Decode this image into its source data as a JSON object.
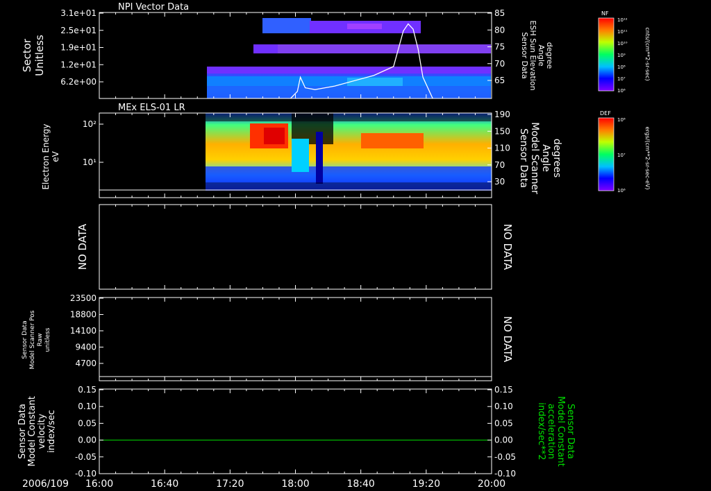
{
  "chart_data": [
    {
      "type": "heatmap",
      "title": "NPI Vector Data",
      "ylabel": [
        "Sector",
        "Unitless"
      ],
      "yticks": [
        "3.1e+01",
        "2.5e+01",
        "1.9e+01",
        "1.2e+01",
        "6.2e+00"
      ],
      "right_ylabel": [
        "Sensor Data",
        "ESH Sun Elevation",
        "Angle",
        "degree"
      ],
      "right_yticks": [
        "85",
        "80",
        "75",
        "70",
        "65"
      ],
      "right_ylim": [
        61,
        85
      ],
      "line_series": {
        "time_hours": [
          17.5,
          17.95,
          18.02,
          18.05,
          18.1,
          18.2,
          18.4,
          18.8,
          19.0,
          19.1,
          19.15,
          19.2,
          19.25,
          19.3,
          19.4
        ],
        "values": [
          61,
          61,
          63,
          67,
          64,
          63.5,
          64.5,
          67.5,
          70,
          80,
          82,
          80.5,
          75,
          67,
          61
        ]
      },
      "colorbar": {
        "label": "NF",
        "ticks": [
          "10¹²",
          "10¹¹",
          "10¹⁰",
          "10⁹",
          "10⁸",
          "10⁷",
          "10⁶"
        ],
        "units": "cnts/(cm**2-sr-sec)"
      }
    },
    {
      "type": "heatmap",
      "title": "MEx ELS-01 LR",
      "ylabel": [
        "Electron Energy",
        "eV"
      ],
      "yticks": [
        "10²",
        "10¹"
      ],
      "yscale": "log",
      "right_ylabel": [
        "Sensor Data",
        "Model Scanner",
        "Angle",
        "degrees"
      ],
      "right_yticks": [
        "190",
        "150",
        "110",
        "70",
        "30"
      ],
      "colorbar": {
        "label": "DEF",
        "ticks": [
          "10⁸",
          "10⁷",
          "10⁶"
        ],
        "units": "ergs/(cm**2-sr-sec-eV)"
      }
    },
    {
      "type": "line",
      "note_left": "NO DATA",
      "note_right": "NO DATA"
    },
    {
      "type": "line",
      "ylabel": [
        "Sensor Data",
        "Model Scanner Pos",
        "Raw",
        "unitless"
      ],
      "yticks": [
        "23500",
        "18800",
        "14100",
        "9400",
        "4700"
      ],
      "note_right": "NO DATA"
    },
    {
      "type": "line",
      "ylabel": [
        "Sensor Data",
        "Model Constant",
        "velocity",
        "index/sec"
      ],
      "yticks": [
        "0.15",
        "0.10",
        "0.05",
        "0.00",
        "-0.05",
        "-0.10"
      ],
      "right_ylabel": [
        "Sensor Data",
        "Model Constant",
        "acceleration",
        "index/sec**2"
      ],
      "right_yticks": [
        "0.15",
        "0.10",
        "0.05",
        "0.00",
        "-0.05",
        "-0.10"
      ],
      "ylim": [
        -0.1,
        0.15
      ],
      "series_values": [
        0,
        0
      ],
      "series_color": "#00e000"
    }
  ],
  "x_axis": {
    "date_label": "2006/109",
    "ticks": [
      "16:00",
      "16:40",
      "17:20",
      "18:00",
      "18:40",
      "19:20",
      "20:00"
    ],
    "range_hours": [
      16,
      20
    ]
  }
}
